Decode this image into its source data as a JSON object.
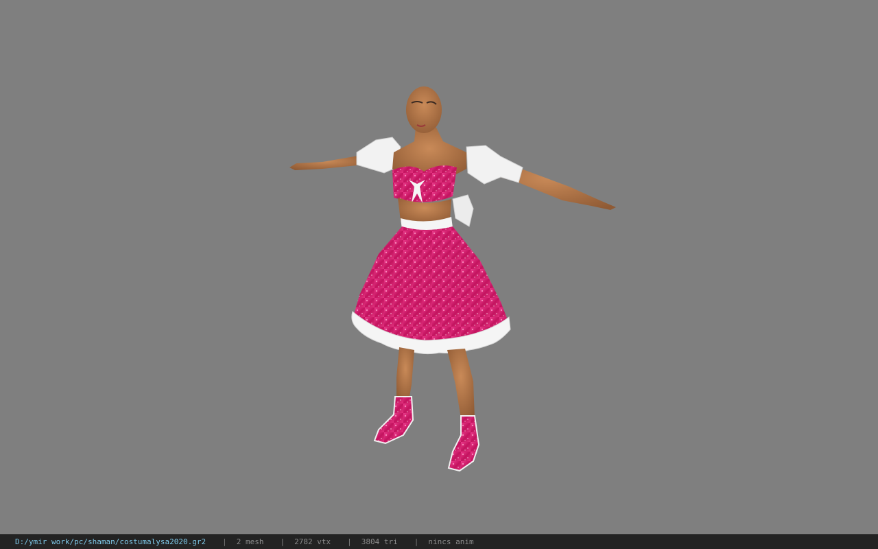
{
  "viewer": {
    "background_color": "#7f7f7f",
    "model": {
      "description_icon": "3d-character-model",
      "costume_colors": {
        "skin": "#b97a4c",
        "dress_pink": "#d81f73",
        "ruffle_white": "#f2f2f2"
      }
    }
  },
  "status_bar": {
    "file_path": "D:/ymir work/pc/shaman/costumalysa2020.gr2",
    "separator": "|",
    "mesh_count": "2 mesh",
    "vertex_count": "2782 vtx",
    "triangle_count": "3804 tri",
    "anim_status": "nincs anim"
  }
}
